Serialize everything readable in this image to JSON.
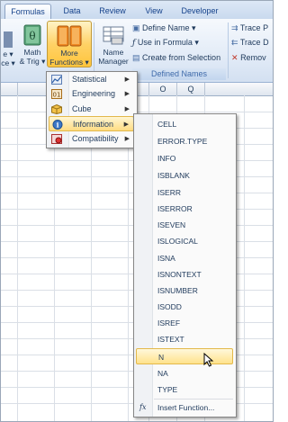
{
  "tabs": [
    "Formulas",
    "Data",
    "Review",
    "View",
    "Developer"
  ],
  "ribbon": {
    "left_partial_1": "e ▾",
    "left_partial_2": "ce ▾",
    "math_trig": [
      "Math",
      "& Trig ▾"
    ],
    "more_functions": [
      "More",
      "Functions ▾"
    ],
    "name_manager": [
      "Name",
      "Manager"
    ],
    "define_name": "Define Name ▾",
    "use_in_formula": "Use in Formula ▾",
    "create_from_selection": "Create from Selection",
    "defined_names_label": "Defined Names",
    "trace_prec": "Trace P",
    "trace_dep": "Trace D",
    "remove": "Remov"
  },
  "columns": [
    "O",
    "Q"
  ],
  "more_functions_menu": [
    {
      "label": "Statistical",
      "icon": "statistical-icon"
    },
    {
      "label": "Engineering",
      "icon": "engineering-icon"
    },
    {
      "label": "Cube",
      "icon": "cube-icon"
    },
    {
      "label": "Information",
      "icon": "information-icon",
      "selected": true
    },
    {
      "label": "Compatibility",
      "icon": "compatibility-icon"
    }
  ],
  "information_functions": [
    "CELL",
    "ERROR.TYPE",
    "INFO",
    "ISBLANK",
    "ISERR",
    "ISERROR",
    "ISEVEN",
    "ISLOGICAL",
    "ISNA",
    "ISNONTEXT",
    "ISNUMBER",
    "ISODD",
    "ISREF",
    "ISTEXT",
    "N",
    "NA",
    "TYPE"
  ],
  "hovered_function": "N",
  "insert_function": "Insert Function...",
  "fx_symbol": "fx",
  "accent_color": "#ffc53d"
}
